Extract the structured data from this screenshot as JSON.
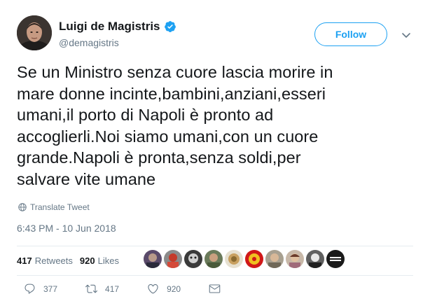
{
  "tweet": {
    "author_name": "Luigi de Magistris",
    "handle": "@demagistris",
    "follow_label": "Follow",
    "text": "Se un Ministro senza cuore lascia morire in\nmare donne incinte,bambini,anziani,esseri\numani,il porto di Napoli è pronto ad\naccoglierli.Noi siamo umani,con un cuore\ngrande.Napoli è pronta,senza soldi,per\nsalvare vite umane",
    "translate_label": "Translate Tweet",
    "timestamp": "6:43 PM - 10 Jun 2018"
  },
  "stats": {
    "retweets_count": "417",
    "retweets_label": "Retweets",
    "likes_count": "920",
    "likes_label": "Likes"
  },
  "actions": {
    "reply_count": "377",
    "retweet_count": "417",
    "like_count": "920"
  },
  "colors": {
    "accent": "#1da1f2",
    "muted": "#657786",
    "text": "#14171a"
  }
}
